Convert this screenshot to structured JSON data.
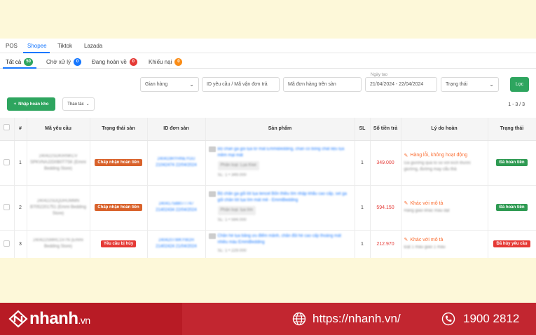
{
  "platform_tabs": [
    "POS",
    "Shopee",
    "Tiktok",
    "Lazada"
  ],
  "status_tabs": [
    {
      "label": "Tất cả",
      "count": "50"
    },
    {
      "label": "Chờ xử lý",
      "count": "0"
    },
    {
      "label": "Đang hoàn về",
      "count": "0"
    },
    {
      "label": "Khiếu nại",
      "count": "0"
    }
  ],
  "filters": {
    "shop": "Gian hàng",
    "request_id": "ID yêu cầu / Mã vận đơn trả",
    "order_id": "Mã đơn hàng trên sàn",
    "date_label": "Ngày tạo",
    "date_range": "21/04/2024 - 22/04/2024",
    "status": "Trạng thái",
    "filter_button": "Lọc"
  },
  "toolbar": {
    "import_button": "Nhập hoàn kho",
    "action_button": "Thao tác",
    "pagination": "1 - 3 / 3"
  },
  "table": {
    "headers": {
      "num": "#",
      "request_code": "Mã yêu cầu",
      "platform_status": "Trạng thái sàn",
      "order_id": "ID đơn sàn",
      "product": "Sản phẩm",
      "qty": "SL",
      "amount": "Số tiền trả",
      "reason": "Lý do hoàn",
      "status": "Trạng thái"
    },
    "rows": [
      {
        "num": "1",
        "request_code": "240422SDKIRNKCV SPKVNAJ2D0B0T7SK (Emmi Bedding Store)",
        "platform_status": "Chấp nhận hoàn tiền",
        "order_id": "240419RYHNEYGU 21042474 22/04/2024",
        "product": "Bộ chăn ga gối lụa tơ mát EmmiBedding, chăn có bông chất liệu lụa mềm mại mát",
        "variant": "Phân loại: Lụa Kiwi",
        "product_meta": "SL: 1 • 349.000",
        "qty": "1",
        "amount": "349.000",
        "reason_title": "Hàng lỗi, không hoạt động",
        "reason_desc": "Ga giường quá to so với kích thước giường, đường may cẩu thả",
        "status": "Đã hoàn tiền"
      },
      {
        "num": "2",
        "request_code": "240422SDQDHUMMN B7052201751 (Emmi Bedding Store)",
        "platform_status": "Chấp nhận hoàn tiền",
        "order_id": "240417588077747 21402434 22/04/2024",
        "product": "Bộ chăn ga gối lót lụa tencel Bốn thiều tím nhập khẩu cao cấp, set ga gối chăn lót lụa tím mát mẻ - EmmiBedding",
        "variant": "Phân loại: lụa tím",
        "product_meta": "SL: 1 • 594.000",
        "qty": "1",
        "amount": "594.150",
        "reason_title": "Khác với mô tả",
        "reason_desc": "Hàng giao khác màu đặt",
        "status": "Đã hoàn tiền"
      },
      {
        "num": "3",
        "request_code": "240422SMRC1V7N (Emmi Bedding Store)",
        "platform_status": "Yêu cầu bị hủy",
        "order_id": "240420TWKYW2H 21402424 21/04/2024",
        "product": "Chăn hè lụa băng ưu điểm mảnh, chăn đũi hè cao cấp thoáng mát nhiều màu EmmiBedding",
        "variant": "",
        "product_meta": "SL: 1 • 229.000",
        "qty": "1",
        "amount": "212.970",
        "reason_title": "Khác với mô tả",
        "reason_desc": "Đặt 1 màu giao 1 màu",
        "status": "Đã hủy yêu cầu"
      }
    ]
  },
  "footer": {
    "brand": "nhanh",
    "brand_suffix": ".vn",
    "website": "https://nhanh.vn/",
    "phone": "1900 2812"
  },
  "colors": {
    "accent_blue": "#1677ff",
    "green": "#2ea55f",
    "red": "#e53935",
    "footer_red": "#b81b25",
    "top_bg": "#fdf8d9"
  }
}
